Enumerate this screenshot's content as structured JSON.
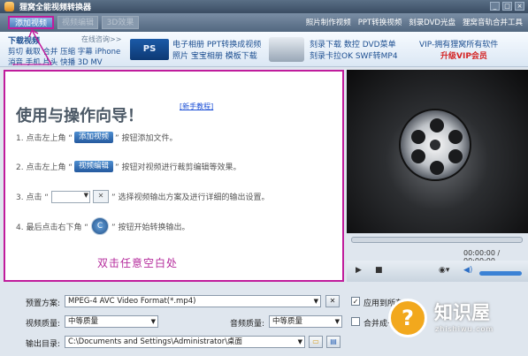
{
  "window": {
    "title": "狸窝全能视频转换器",
    "min": "_",
    "max": "□",
    "close": "×"
  },
  "toolbar": {
    "add_video": "添加视频",
    "edit_video": "视频编辑",
    "settings": "3D效果",
    "links": [
      "照片制作视频",
      "PPT转换视频",
      "刻录DVD光盘",
      "狸窝音轨合并工具"
    ]
  },
  "banner": {
    "download_title": "下载视频",
    "download_more": "在线咨询>>",
    "download_row1": "剪切 截取 合并 压缩 字幕 iPhone",
    "download_row2": "消音 手机 片头 快播 3D MV",
    "ps_icon": "PS",
    "photo_row1": "电子相册 PPT转换成视频",
    "photo_row2": "照片 宝宝相册 模板下载",
    "dvd_row1": "刻录下载 数控 DVD菜单",
    "dvd_row2": "刻录卡拉OK SWF转MP4",
    "vip_row1": "VIP-拥有狸窝所有软件",
    "vip_row2": "升级VIP会员"
  },
  "guide": {
    "title": "使用与操作向导！",
    "tutorial_link": "[新手教程]",
    "step1_pre": "1. 点击左上角 “",
    "step1_btn": "添加视频",
    "step1_post": "” 按钮添加文件。",
    "step2_pre": "2. 点击左上角 “",
    "step2_btn": "视频编辑",
    "step2_post": "” 按钮对视频进行裁剪编辑等效果。",
    "step3_pre": "3. 点击 “",
    "step3_post": "” 选择视频输出方案及进行详细的输出设置。",
    "step4_pre": "4. 最后点击右下角 “",
    "step4_post": "” 按钮开始转换输出。",
    "handwriting": "双击任意空白处"
  },
  "player": {
    "time": "00:00:00 / 00:00:00",
    "play": "▶",
    "stop": "■",
    "snapshot": "◉▾",
    "volume": "◀)"
  },
  "settings": {
    "preset_label": "预置方案:",
    "preset_value": "MPEG-4 AVC Video Format(*.mp4)",
    "apply_all_label": "应用到所有",
    "video_quality_label": "视频质量:",
    "video_quality_value": "中等质量",
    "audio_quality_label": "音频质量:",
    "audio_quality_value": "中等质量",
    "merge_label": "合并成一个文件",
    "output_label": "输出目录:",
    "output_value": "C:\\Documents and Settings\\Administrator\\桌面"
  },
  "watermark": {
    "symbol": "?",
    "name": "知识屋",
    "domain": "zhishiwu.com"
  }
}
